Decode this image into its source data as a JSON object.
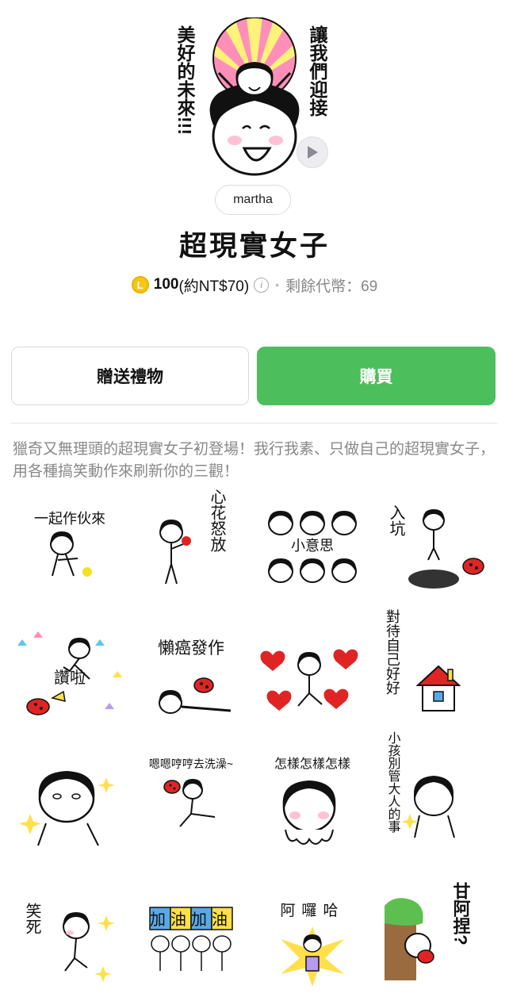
{
  "hero": {
    "left_caption": "美好的未來!!!",
    "right_caption": "讓我們迎接"
  },
  "author": {
    "name": "martha"
  },
  "product": {
    "title": "超現實女子",
    "coin_symbol": "L",
    "price": "100",
    "price_local": "(約NT$70)",
    "info_symbol": "i",
    "separator": "•",
    "remaining": "剩餘代幣：69"
  },
  "actions": {
    "gift_label": "贈送禮物",
    "buy_label": "購買"
  },
  "colors": {
    "buy_green": "#4cbe5c",
    "coin_gold": "#f5c518",
    "ladybug_red": "#e02424"
  },
  "description": "獵奇又無理頭的超現實女子初登場！我行我素、只做自己的超現實女子，用各種搞笑動作來刷新你的三觀！",
  "stickers": [
    {
      "caption": "一起作伙來"
    },
    {
      "caption": "心花怒放"
    },
    {
      "caption": "小意思"
    },
    {
      "caption": "入坑"
    },
    {
      "caption": "讚啦"
    },
    {
      "caption": "懶癌發作"
    },
    {
      "caption": ""
    },
    {
      "caption": "對待自己好好"
    },
    {
      "caption": ""
    },
    {
      "caption": "嗯嗯哼哼去洗澡~"
    },
    {
      "caption": "怎樣怎樣怎樣"
    },
    {
      "caption": "小孩別管大人的事"
    },
    {
      "caption": "笑死"
    },
    {
      "caption": "加油加油"
    },
    {
      "caption": "阿囉哈"
    },
    {
      "caption": "甘阿捏?"
    }
  ]
}
